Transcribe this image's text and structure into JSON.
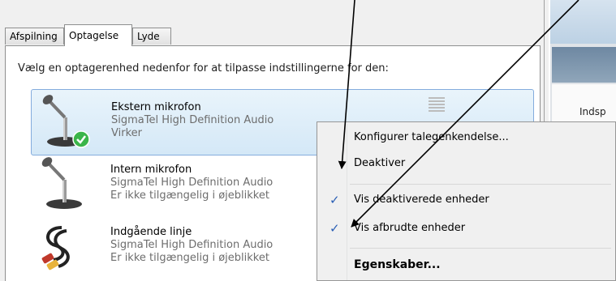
{
  "tabs": [
    {
      "label": "Afspilning",
      "active": false
    },
    {
      "label": "Optagelse",
      "active": true
    },
    {
      "label": "Lyde",
      "active": false
    }
  ],
  "instruction": "Vælg en optagerenhed nedenfor for at tilpasse indstillingerne for den:",
  "devices": [
    {
      "name": "Ekstern mikrofon",
      "driver": "SigmaTel High Definition Audio",
      "status": "Virker",
      "icon": "microphone-icon",
      "selected": true,
      "default": true
    },
    {
      "name": "Intern mikrofon",
      "driver": "SigmaTel High Definition Audio",
      "status": "Er ikke tilgængelig i øjeblikket",
      "icon": "microphone-icon",
      "selected": false
    },
    {
      "name": "Indgående linje",
      "driver": "SigmaTel High Definition Audio",
      "status": "Er ikke tilgængelig i øjeblikket",
      "icon": "line-in-cable-icon",
      "selected": false
    }
  ],
  "background_window": {
    "text": "Indsp"
  },
  "context_menu": {
    "items": [
      {
        "label": "Konfigurer talegenkendelse...",
        "checked": false
      },
      {
        "label": "Deaktiver",
        "checked": false
      },
      {
        "label": "Vis deaktiverede enheder",
        "checked": true
      },
      {
        "label": "Vis afbrudte enheder",
        "checked": true
      },
      {
        "label": "Egenskaber...",
        "checked": false,
        "bold": true
      }
    ],
    "check_glyph": "✓"
  },
  "colors": {
    "accent": "#2a5fb5",
    "selection": "#d4e8f7",
    "check_badge": "#3bb54a"
  }
}
